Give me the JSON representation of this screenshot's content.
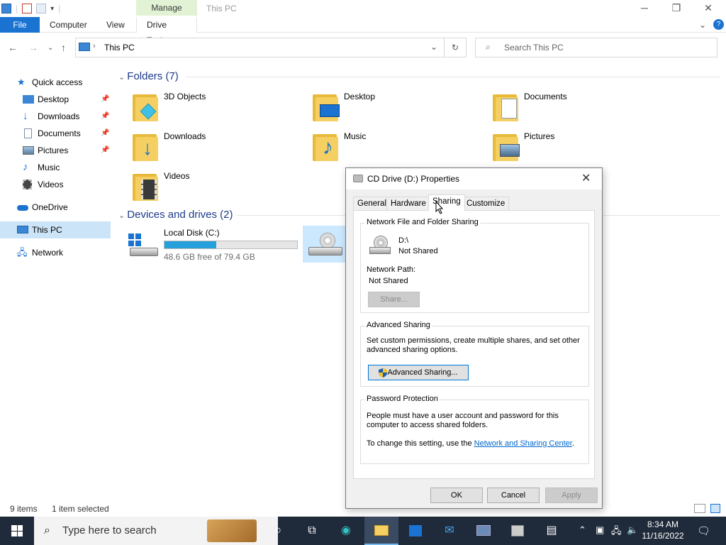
{
  "window": {
    "title": "This PC",
    "context_tab": "Manage",
    "minimize": "─",
    "maximize": "❐",
    "close": "✕",
    "expand": "⌄",
    "help": "?"
  },
  "ribbon": {
    "file": "File",
    "computer": "Computer",
    "view": "View",
    "drive_tools": "Drive Tools"
  },
  "address": {
    "path": "This PC",
    "search_placeholder": "Search This PC"
  },
  "sidebar": {
    "quick_access": "Quick access",
    "items": [
      {
        "label": "Desktop",
        "pinned": true
      },
      {
        "label": "Downloads",
        "pinned": true
      },
      {
        "label": "Documents",
        "pinned": true
      },
      {
        "label": "Pictures",
        "pinned": true
      },
      {
        "label": "Music",
        "pinned": false
      },
      {
        "label": "Videos",
        "pinned": false
      }
    ],
    "onedrive": "OneDrive",
    "this_pc": "This PC",
    "network": "Network"
  },
  "folders": {
    "heading": "Folders (7)",
    "items": [
      "3D Objects",
      "Desktop",
      "Documents",
      "Downloads",
      "Music",
      "Pictures",
      "Videos"
    ]
  },
  "devices": {
    "heading": "Devices and drives (2)",
    "local_disk": {
      "name": "Local Disk (C:)",
      "free": "48.6 GB free of 79.4 GB",
      "used_fraction": 0.388
    }
  },
  "status": {
    "count": "9 items",
    "selected": "1 item selected"
  },
  "taskbar": {
    "search_placeholder": "Type here to search",
    "time": "8:34 AM",
    "date": "11/16/2022"
  },
  "dialog": {
    "title": "CD Drive (D:) Properties",
    "tabs": [
      "General",
      "Hardware",
      "Sharing",
      "Customize"
    ],
    "nffs": {
      "heading": "Network File and Folder Sharing",
      "drive": "D:\\",
      "drive_state": "Not Shared",
      "path_label": "Network Path:",
      "path_value": "Not Shared",
      "share_button": "Share..."
    },
    "advanced": {
      "heading": "Advanced Sharing",
      "description_1": "Set custom permissions, create multiple shares, and set other",
      "description_2": "advanced sharing options.",
      "button": "Advanced Sharing..."
    },
    "password": {
      "heading": "Password Protection",
      "line_1": "People must have a user account and password for this",
      "line_2": "computer to access shared folders.",
      "change_prefix": "To change this setting, use the ",
      "link": "Network and Sharing Center",
      "change_suffix": "."
    },
    "ok": "OK",
    "cancel": "Cancel",
    "apply": "Apply"
  },
  "colors": {
    "accent": "#1a73d1",
    "selection": "#cce4f7",
    "drive_fill": "#26a0da",
    "taskbar": "#1f2a3a",
    "manage_tab": "#e2f2d4"
  }
}
